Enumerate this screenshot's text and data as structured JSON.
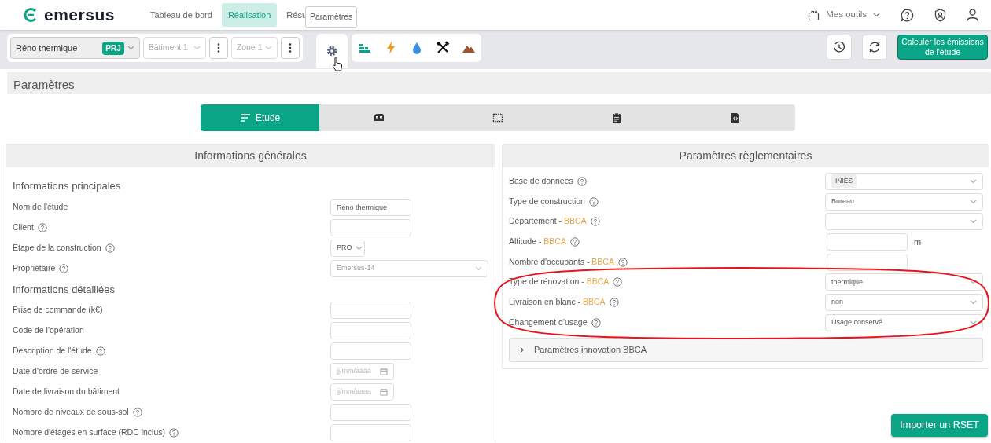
{
  "app": {
    "logo": "emersus"
  },
  "nav": [
    {
      "label": "Tableau de bord",
      "selected": false
    },
    {
      "label": "Réalisation",
      "selected": true
    },
    {
      "label": "Résu",
      "selected": false
    }
  ],
  "tooltip": "Paramètres",
  "header_tools": {
    "label": "Mes outils"
  },
  "toolbar": {
    "project": {
      "value": "Réno thermique",
      "badge": "PRJ"
    },
    "building": {
      "value": "Bâtiment 1",
      "disabled": true
    },
    "zone": {
      "value": "Zone 1",
      "disabled": true
    },
    "modules": [
      {
        "selected": true
      },
      {
        "selected": false
      },
      {
        "selected": false
      },
      {
        "selected": false
      },
      {
        "selected": false
      },
      {
        "selected": false
      }
    ],
    "calculate": "Calculer les émissions de l'étude"
  },
  "page_title": "Paramètres",
  "tabs": [
    {
      "label": "Etude",
      "selected": true
    },
    {
      "selected": false
    },
    {
      "selected": false
    },
    {
      "selected": false
    },
    {
      "selected": false
    }
  ],
  "general": {
    "title": "Informations générales",
    "sections": [
      {
        "title": "Informations principales",
        "rows": [
          {
            "label": "Nom de l'étude",
            "help": false,
            "kind": "text",
            "value": "Réno thermique"
          },
          {
            "label": "Client",
            "help": true,
            "kind": "text"
          },
          {
            "label": "Etape de la construction",
            "help": true,
            "kind": "short-select",
            "value": "PRO"
          },
          {
            "label": "Propriétaire",
            "help": true,
            "kind": "select",
            "value": "Emersus-14",
            "disabled": true
          }
        ]
      },
      {
        "title": "Informations détaillées",
        "rows": [
          {
            "label": "Prise de commande (k€)",
            "help": false,
            "kind": "text"
          },
          {
            "label": "Code de l'opération",
            "help": false,
            "kind": "text"
          },
          {
            "label": "Description de l'étude",
            "help": true,
            "kind": "text"
          },
          {
            "label": "Date d'ordre de service",
            "help": false,
            "kind": "date",
            "placeholder": "jj/mm/aaaa"
          },
          {
            "label": "Date de livraison du bâtiment",
            "help": false,
            "kind": "date",
            "placeholder": "jj/mm/aaaa"
          },
          {
            "label": "Nombre de niveaux de sous-sol",
            "help": true,
            "kind": "text"
          },
          {
            "label": "Nombre d'étages en surface (RDC inclus)",
            "help": true,
            "kind": "text"
          }
        ]
      }
    ]
  },
  "regulatory": {
    "title": "Paramètres règlementaires",
    "rows": [
      {
        "label": "Base de données",
        "help": true,
        "kind": "chip-select",
        "value": "INIES"
      },
      {
        "label": "Type de construction",
        "help": true,
        "kind": "select",
        "value": "Bureau"
      },
      {
        "label": "Département -",
        "tag": "BBCA",
        "help": true,
        "kind": "select"
      },
      {
        "label": "Altitude -",
        "tag": "BBCA",
        "help": true,
        "kind": "text",
        "unit": "m"
      },
      {
        "label": "Nombre d'occupants -",
        "tag": "BBCA",
        "help": true,
        "kind": "text"
      },
      {
        "label": "Type de rénovation -",
        "tag": "BBCA",
        "help": true,
        "kind": "select",
        "value": "thermique"
      },
      {
        "label": "Livraison en blanc -",
        "tag": "BBCA",
        "help": true,
        "kind": "select",
        "value": "non"
      },
      {
        "label": "Changement d'usage",
        "help": true,
        "kind": "select",
        "value": "Usage conservé"
      }
    ],
    "accordion": {
      "label": "Paramètres innovation BBCA",
      "expanded": false
    }
  },
  "highlight": {
    "kind": "ellipse"
  },
  "import_button": "Importer un RSET"
}
